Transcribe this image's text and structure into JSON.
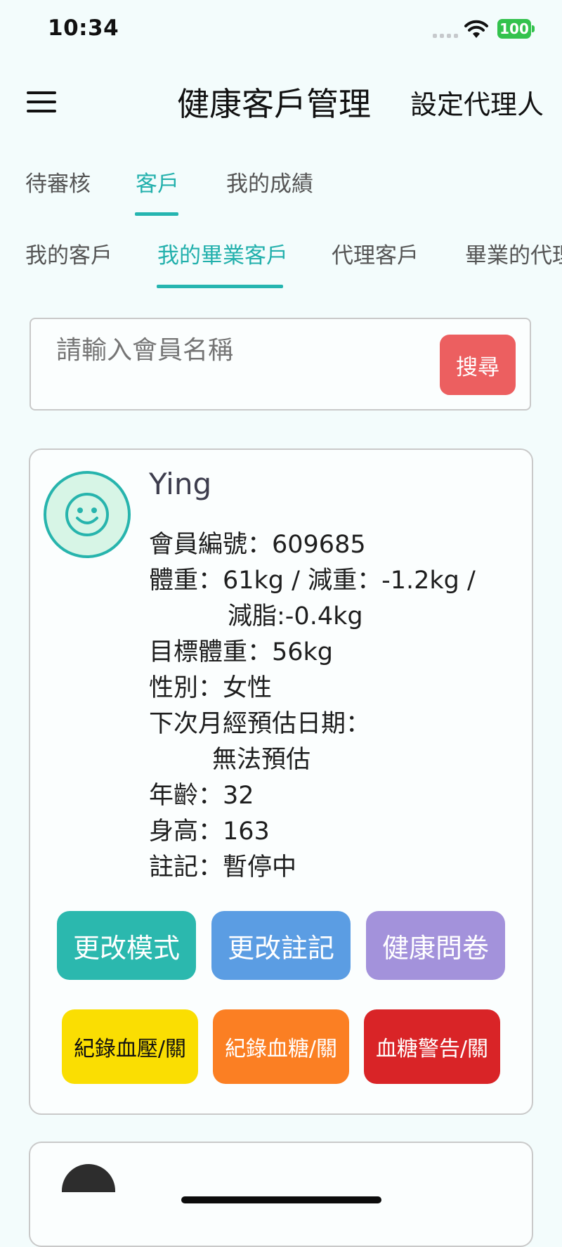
{
  "status_bar": {
    "time": "10:34",
    "battery": "100"
  },
  "header": {
    "title": "健康客戶管理",
    "proxy_button": "設定代理人"
  },
  "main_tabs": [
    {
      "label": "待審核",
      "active": false
    },
    {
      "label": "客戶",
      "active": true
    },
    {
      "label": "我的成績",
      "active": false
    }
  ],
  "sub_tabs": [
    {
      "label": "我的客戶",
      "active": false
    },
    {
      "label": "我的畢業客戶",
      "active": true
    },
    {
      "label": "代理客戶",
      "active": false
    },
    {
      "label": "畢業的代理",
      "active": false
    }
  ],
  "search": {
    "placeholder": "請輸入會員名稱",
    "button": "搜尋"
  },
  "customer": {
    "name": "Ying",
    "member_id": "會員編號：609685",
    "weight_line1": "體重：61kg / 減重：-1.2kg /",
    "weight_line2": "減脂:-0.4kg",
    "target_weight": "目標體重：56kg",
    "gender": "性別：女性",
    "period_label": "下次月經預估日期：",
    "period_value": "無法預估",
    "age": "年齡：32",
    "height": "身高：163",
    "note": "註記：暫停中",
    "avatar_icon": "smiley-face-icon"
  },
  "actions": {
    "change_mode": "更改模式",
    "change_note": "更改註記",
    "health_survey": "健康問卷",
    "record_bp": "紀錄血壓/關",
    "record_bs": "紀錄血糖/關",
    "bs_warning": "血糖警告/關"
  },
  "colors": {
    "accent": "#25b5b0",
    "search_button": "#ec5f60",
    "change_mode": "#2bb8ae",
    "change_note": "#5b9de3",
    "health_survey": "#a392db",
    "record_bp": "#fade02",
    "record_bs": "#fb7f23",
    "bs_warning": "#d92427"
  }
}
